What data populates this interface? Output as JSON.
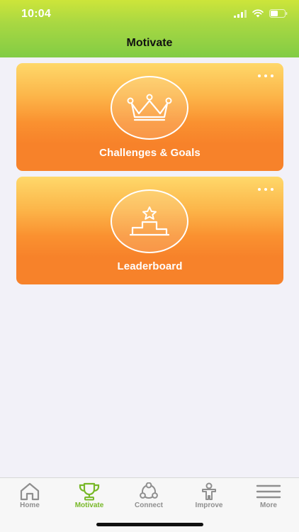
{
  "status_bar": {
    "time": "10:04"
  },
  "nav": {
    "title": "Motivate"
  },
  "cards": [
    {
      "label": "Challenges & Goals",
      "icon": "crown-icon"
    },
    {
      "label": "Leaderboard",
      "icon": "podium-icon"
    }
  ],
  "tabs": [
    {
      "label": "Home",
      "icon": "home-icon",
      "active": false
    },
    {
      "label": "Motivate",
      "icon": "trophy-icon",
      "active": true
    },
    {
      "label": "Connect",
      "icon": "connect-icon",
      "active": false
    },
    {
      "label": "Improve",
      "icon": "person-icon",
      "active": false
    },
    {
      "label": "More",
      "icon": "menu-icon",
      "active": false
    }
  ],
  "colors": {
    "header_top": "#cde53a",
    "header_bottom": "#82cc45",
    "card_top": "#fed86a",
    "card_bottom": "#f7822a",
    "active_tab": "#78b829",
    "inactive_tab": "#8f8f8f"
  }
}
